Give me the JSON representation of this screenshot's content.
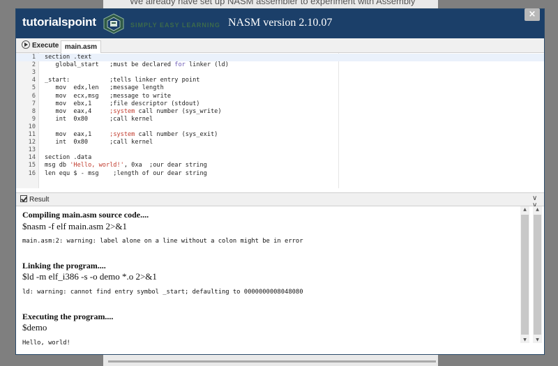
{
  "background": {
    "top_text": "We already have set up NASM assembler to experiment with Assembly"
  },
  "header": {
    "brand": "tutorialspoint",
    "tagline": "SIMPLY EASY LEARNING",
    "title": "NASM version 2.10.07",
    "close_label": "×"
  },
  "toolbar": {
    "execute_label": "Execute",
    "file_tab": "main.asm"
  },
  "editor": {
    "lines": [
      {
        "n": "1",
        "text": "section .text"
      },
      {
        "n": "2",
        "text": "   global_start   ;must be declared for linker (ld)"
      },
      {
        "n": "3",
        "text": ""
      },
      {
        "n": "4",
        "text": "_start:           ;tells linker entry point"
      },
      {
        "n": "5",
        "text": "   mov  edx,len   ;message length"
      },
      {
        "n": "6",
        "text": "   mov  ecx,msg   ;message to write"
      },
      {
        "n": "7",
        "text": "   mov  ebx,1     ;file descriptor (stdout)"
      },
      {
        "n": "8",
        "text": "   mov  eax,4     ;system call number (sys_write)"
      },
      {
        "n": "9",
        "text": "   int  0x80      ;call kernel"
      },
      {
        "n": "10",
        "text": ""
      },
      {
        "n": "11",
        "text": "   mov  eax,1     ;system call number (sys_exit)"
      },
      {
        "n": "12",
        "text": "   int  0x80      ;call kernel"
      },
      {
        "n": "13",
        "text": ""
      },
      {
        "n": "14",
        "text": "section .data"
      },
      {
        "n": "15",
        "text": "msg db 'Hello, world!', 0xa  ;our dear string"
      },
      {
        "n": "16",
        "text": "len equ $ - msg    ;length of our dear string"
      }
    ]
  },
  "result": {
    "label": "Result",
    "compile_head": "Compiling main.asm source code....",
    "compile_cmd": "$nasm -f elf main.asm 2>&1",
    "compile_warning": "main.asm:2: warning: label alone on a line without a colon might be in error",
    "link_head": "Linking the program....",
    "link_cmd": "$ld -m elf_i386 -s -o demo *.o 2>&1",
    "link_warning": "ld: warning: cannot find entry symbol _start; defaulting to 0000000008048080",
    "exec_head": "Executing the program....",
    "exec_cmd": "$demo",
    "program_output": "Hello, world!"
  },
  "colors": {
    "header_bg": "#1b3f69",
    "keyword": "#6c5ab6",
    "string": "#c0392b"
  }
}
